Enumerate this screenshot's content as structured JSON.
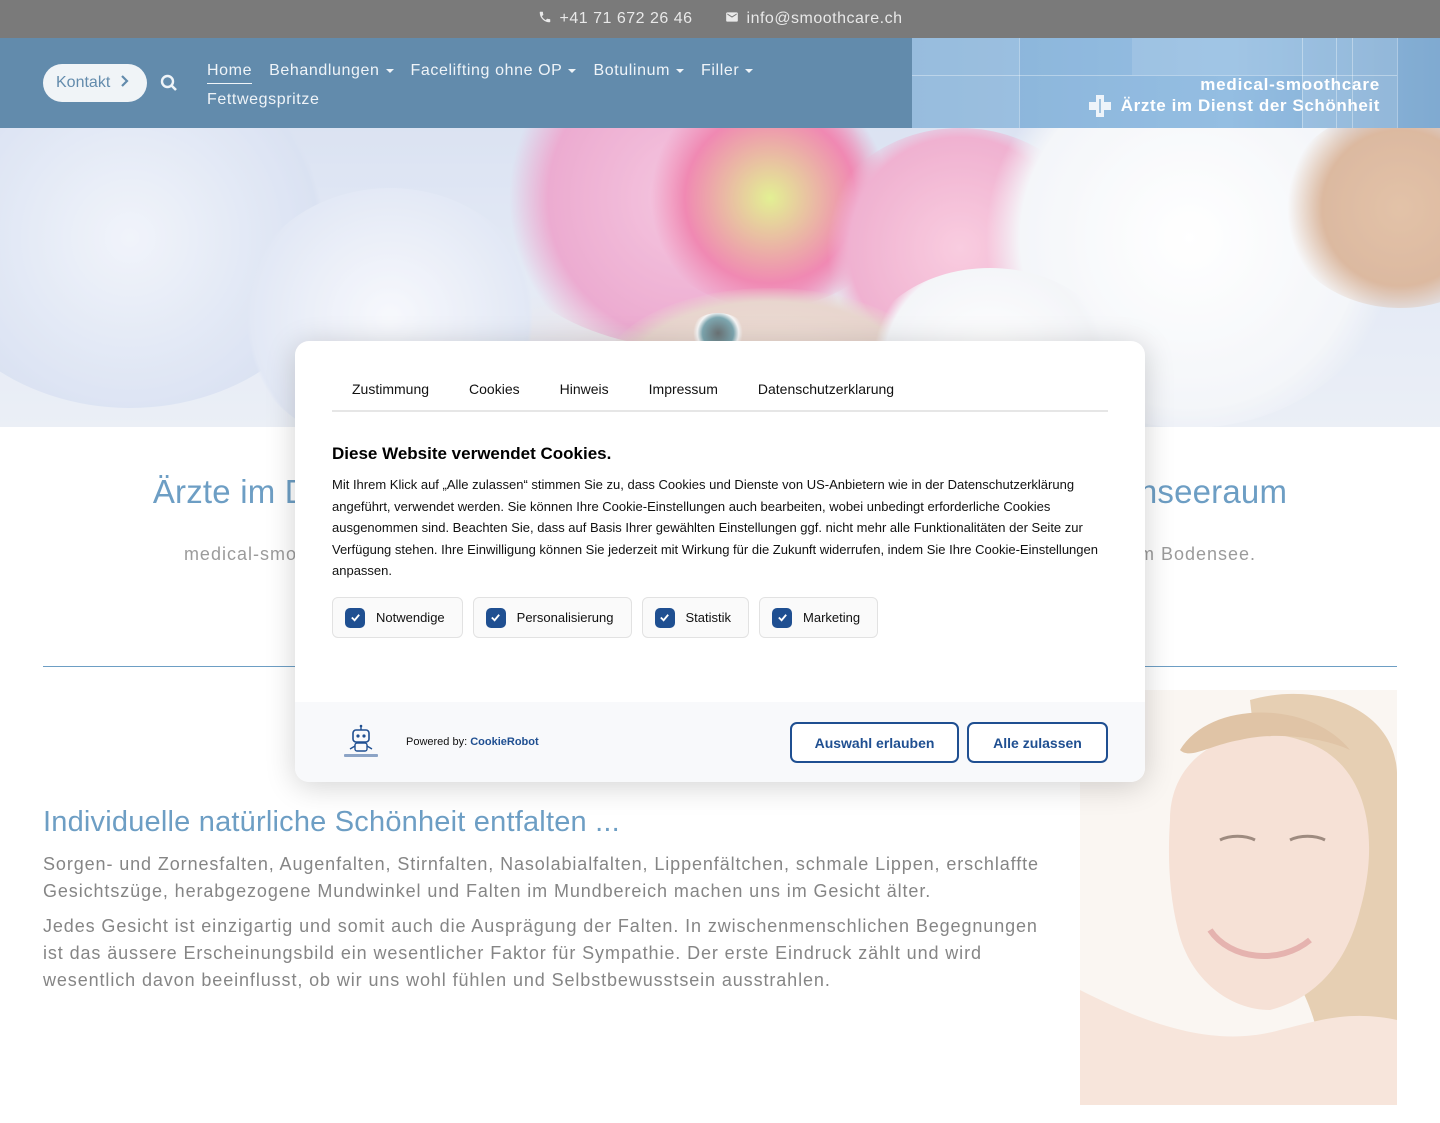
{
  "topbar": {
    "phone": "+41 71 672 26 46",
    "email": "info@smoothcare.ch"
  },
  "header": {
    "contact_label": "Kontakt",
    "nav": [
      {
        "label": "Home",
        "dropdown": false,
        "active": true
      },
      {
        "label": "Behandlungen",
        "dropdown": true
      },
      {
        "label": "Facelifting ohne OP",
        "dropdown": true
      },
      {
        "label": "Botulinum",
        "dropdown": true
      },
      {
        "label": "Filler",
        "dropdown": true
      },
      {
        "label": "Fettwegspritze",
        "dropdown": false
      }
    ],
    "logo_title": "medical-smoothcare",
    "logo_tagline": "Ärzte im Dienst der Schönheit"
  },
  "main": {
    "intro_title_left": "Ärzte im D",
    "intro_title_right": "nseeraum",
    "intro_sub_left": "medical-smoo",
    "intro_sub_right": "am Bodensee.",
    "section_title": "Individuelle natürliche Schönheit entfalten ...",
    "paragraph_1": "Sorgen- und Zornesfalten, Augenfalten, Stirnfalten, Nasolabialfalten, Lippenfältchen, schmale Lippen, erschlaffte Gesichtszüge, herabgezogene Mundwinkel und Falten im Mundbereich machen uns im Gesicht älter.",
    "paragraph_2": "Jedes Gesicht ist einzigartig und somit auch die Ausprägung der Falten. In zwischenmenschlichen Begegnungen ist das äussere Erscheinungsbild ein wesentlicher Faktor für Sympathie. Der erste Eindruck zählt und wird wesentlich davon beeinflusst, ob wir uns wohl fühlen und Selbstbewusstsein ausstrahlen."
  },
  "cookie_modal": {
    "tabs": [
      "Zustimmung",
      "Cookies",
      "Hinweis",
      "Impressum",
      "Datenschutzerklarung"
    ],
    "title": "Diese Website verwendet Cookies.",
    "text": "Mit Ihrem Klick auf „Alle zulassen“ stimmen Sie zu, dass Cookies und Dienste von US-Anbietern wie in der Datenschutzerklärung angeführt, verwendet werden. Sie können Ihre Cookie-Einstellungen auch bearbeiten, wobei unbedingt erforderliche Cookies ausgenommen sind. Beachten Sie, dass auf Basis Ihrer gewählten Einstellungen ggf. nicht mehr alle Funktionalitäten der Seite zur Verfügung stehen. Ihre Einwilligung können Sie jederzeit mit Wirkung für die Zukunft widerrufen, indem Sie Ihre Cookie-Einstellungen anpassen.",
    "checkboxes": [
      {
        "label": "Notwendige",
        "checked": true
      },
      {
        "label": "Personalisierung",
        "checked": true
      },
      {
        "label": "Statistik",
        "checked": true
      },
      {
        "label": "Marketing",
        "checked": true
      }
    ],
    "powered_prefix": "Powered by:",
    "powered_brand": "CookieRobot",
    "btn_selection": "Auswahl erlauben",
    "btn_all": "Alle zulassen",
    "accent_color": "#1f4f91"
  },
  "colors": {
    "topbar_bg": "#333333",
    "header_bg": "#0f4d80",
    "heading_blue": "#1f6aa5"
  }
}
